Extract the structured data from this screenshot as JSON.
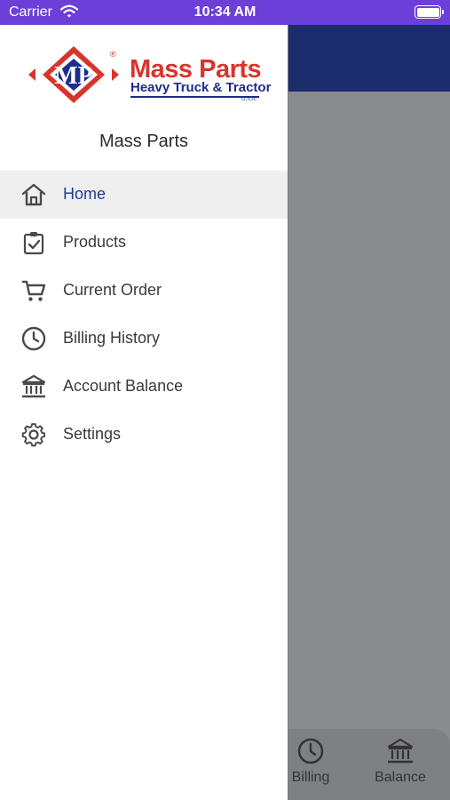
{
  "status_bar": {
    "carrier": "Carrier",
    "time": "10:34 AM"
  },
  "drawer": {
    "logo": {
      "line1": "Mass Parts",
      "line2": "Heavy Truck & Tractor",
      "line3": "U.S.A."
    },
    "title": "Mass Parts",
    "items": [
      {
        "label": "Home",
        "icon": "home-icon",
        "active": true
      },
      {
        "label": "Products",
        "icon": "clipboard-check-icon",
        "active": false
      },
      {
        "label": "Current Order",
        "icon": "cart-icon",
        "active": false
      },
      {
        "label": "Billing History",
        "icon": "clock-icon",
        "active": false
      },
      {
        "label": "Account Balance",
        "icon": "bank-icon",
        "active": false
      },
      {
        "label": "Settings",
        "icon": "gear-icon",
        "active": false
      }
    ]
  },
  "background_tabbar": {
    "billing": "Billing",
    "balance": "Balance"
  },
  "colors": {
    "status_bar": "#6b3fd8",
    "header": "#1c2d6e",
    "active_text": "#1f3b9e",
    "logo_red": "#d9342b",
    "logo_blue": "#1c2d8a"
  }
}
